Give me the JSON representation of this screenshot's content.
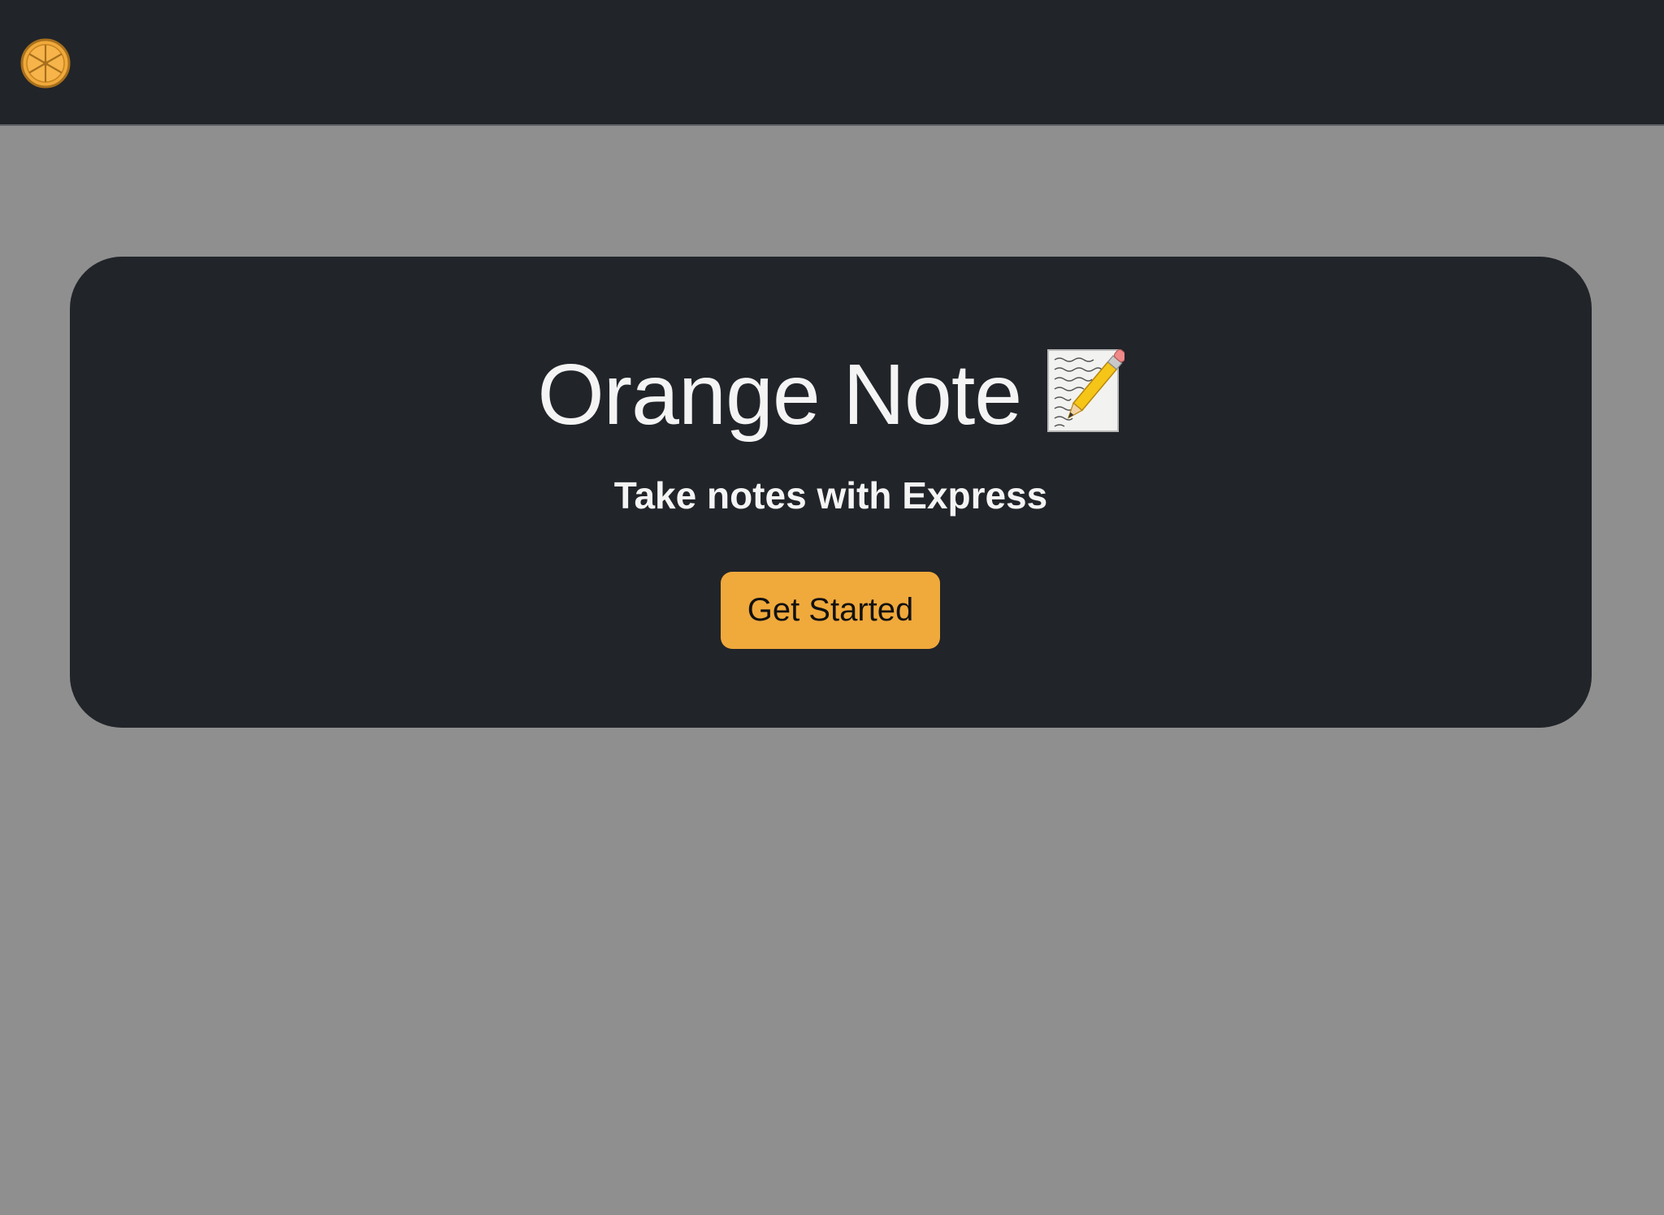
{
  "navbar": {
    "logo_icon": "orange-slice-icon"
  },
  "hero": {
    "title": "Orange Note",
    "title_icon": "memo-pencil-icon",
    "subtitle": "Take notes with Express",
    "cta_label": "Get Started"
  },
  "colors": {
    "page_background": "#8f8f8f",
    "navbar_background": "#212429",
    "card_background": "#212429",
    "accent": "#f0a93b",
    "text_light": "#f4f4f4",
    "text_dark": "#111111"
  }
}
